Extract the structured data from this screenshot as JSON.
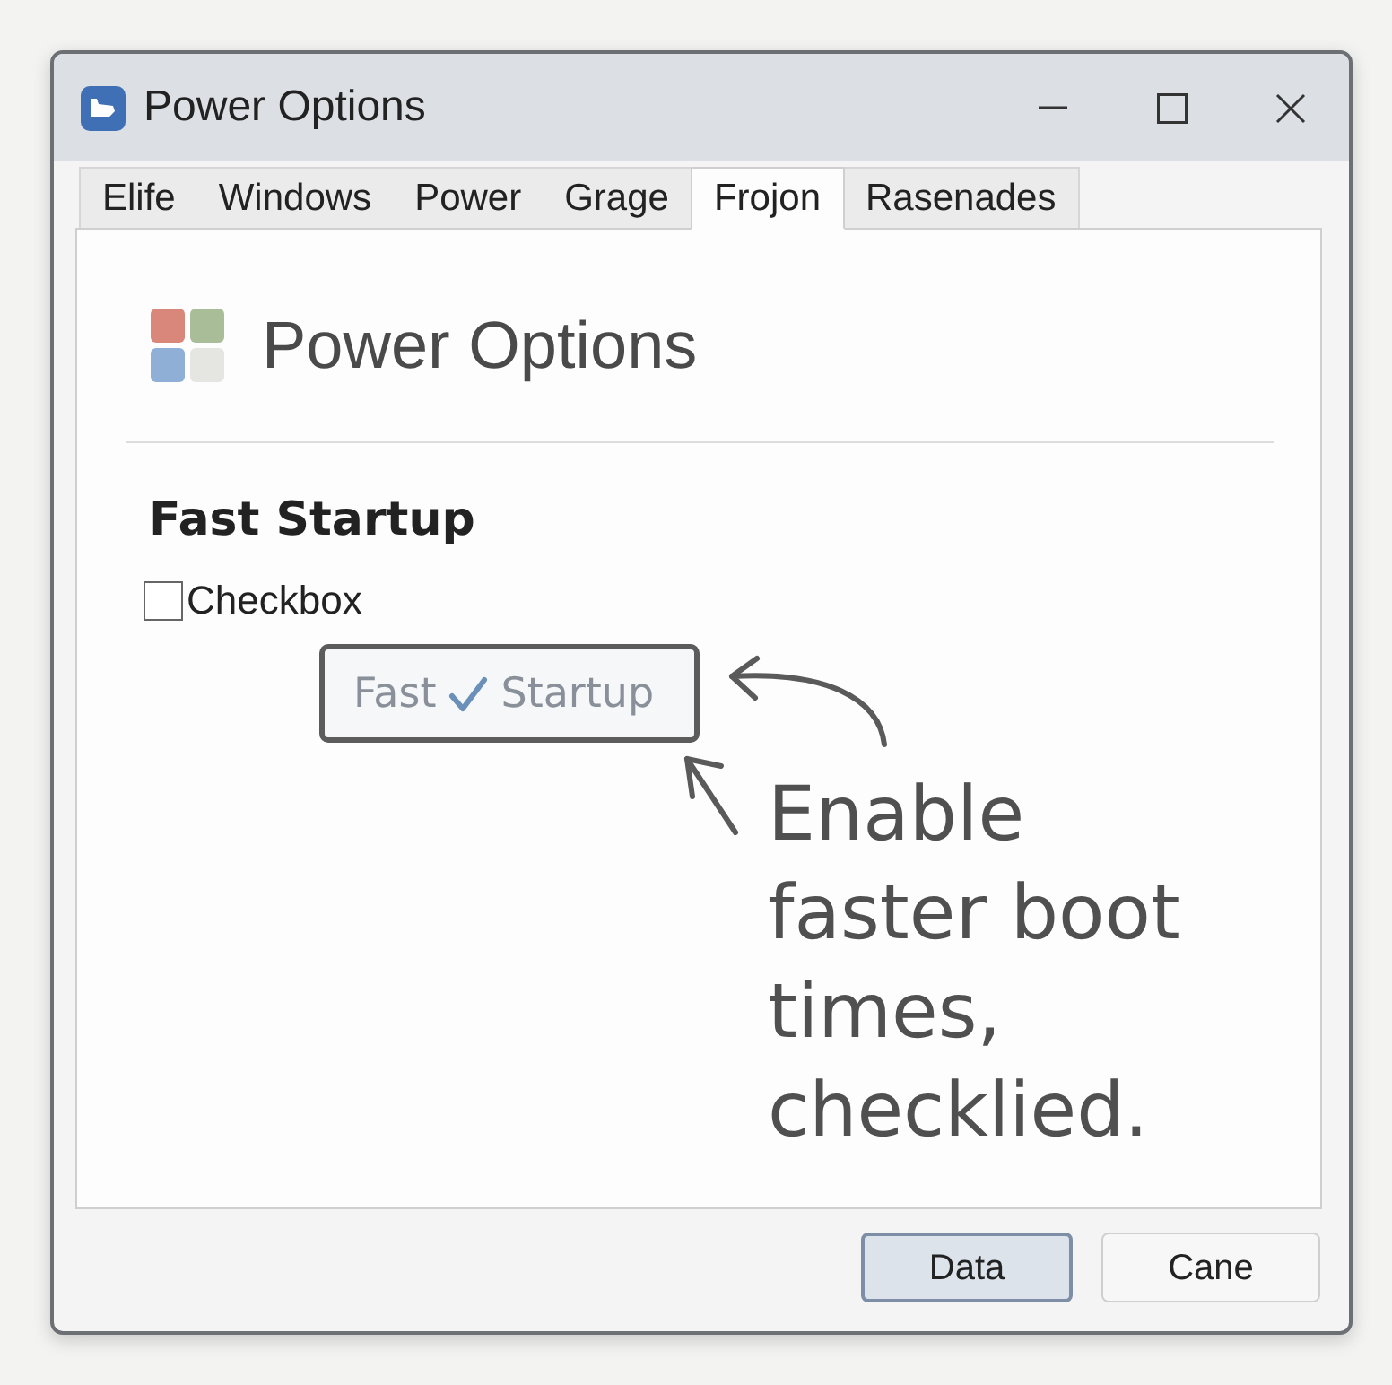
{
  "window": {
    "title": "Power Options"
  },
  "tabs": [
    {
      "label": "Elife",
      "selected": false
    },
    {
      "label": "Windows",
      "selected": false
    },
    {
      "label": "Power",
      "selected": false
    },
    {
      "label": "Grage",
      "selected": false
    },
    {
      "label": "Frojon",
      "selected": true
    },
    {
      "label": "Rasenades",
      "selected": false
    }
  ],
  "panel": {
    "heading": "Power Options",
    "section_title": "Fast Startup",
    "checkbox": {
      "label": "Checkbox",
      "checked": false
    },
    "sketch_toggle": {
      "label_before": "Fast",
      "label_after": "Startup",
      "checked": true
    },
    "annotation": "Enable faster boot times, checklied."
  },
  "buttons": [
    {
      "label": "Data",
      "default": true
    },
    {
      "label": "Cane",
      "default": false
    }
  ]
}
